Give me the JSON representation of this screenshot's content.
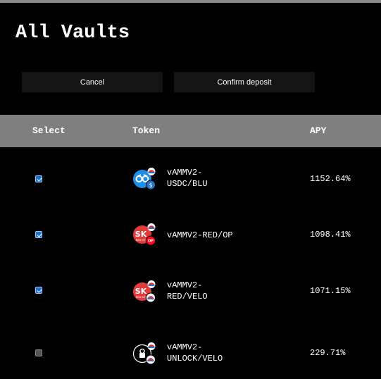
{
  "page": {
    "title": "All Vaults"
  },
  "actions": {
    "cancel_label": "Cancel",
    "confirm_label": "Confirm deposit"
  },
  "table": {
    "headers": {
      "select": "Select",
      "token": "Token",
      "apy": "APY"
    },
    "rows": [
      {
        "checked": true,
        "token_line1": "vAMMV2-",
        "token_line2": "USDC/BLU",
        "apy": "1152.64%",
        "icon": "usdc-blu-pair-icon"
      },
      {
        "checked": true,
        "token_line1": "vAMMV2-RED/OP",
        "token_line2": "",
        "apy": "1098.41%",
        "icon": "red-op-pair-icon"
      },
      {
        "checked": true,
        "token_line1": "vAMMV2-",
        "token_line2": "RED/VELO",
        "apy": "1071.15%",
        "icon": "red-velo-pair-icon"
      },
      {
        "checked": false,
        "token_line1": "vAMMV2-",
        "token_line2": "UNLOCK/VELO",
        "apy": "229.71%",
        "icon": "unlock-velo-pair-icon"
      }
    ]
  },
  "colors": {
    "background": "#000000",
    "header_bg": "#7f7f7f",
    "button_bg": "#141414",
    "checkbox_checked": "#1a6fd4"
  }
}
